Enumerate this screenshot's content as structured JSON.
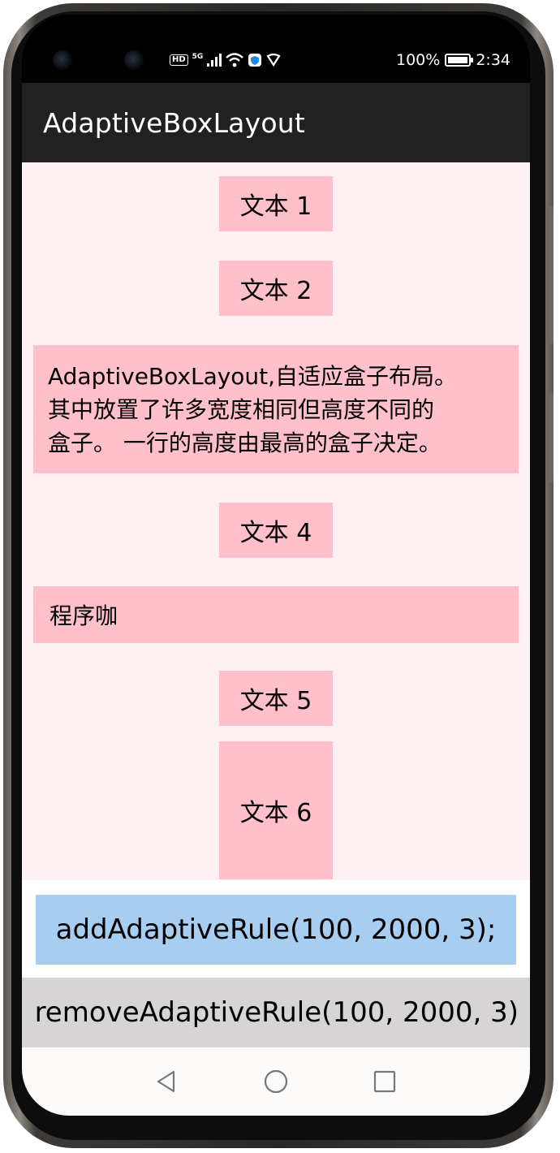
{
  "status_bar": {
    "hd": "HD",
    "network": "5G",
    "battery": "100%",
    "time": "2:34"
  },
  "app_bar": {
    "title": "AdaptiveBoxLayout"
  },
  "boxes": {
    "text1": "文本 1",
    "text2": "文本 2",
    "para_line1": "AdaptiveBoxLayout,自适应盒子布局。",
    "para_line2": "其中放置了许多宽度相同但高度不同的",
    "para_line3": "盒子。 一行的高度由最高的盒子决定。",
    "text4": "文本 4",
    "chengxuka": "程序咖",
    "text5": "文本 5",
    "text6": "文本 6"
  },
  "buttons": {
    "add": "addAdaptiveRule(100, 2000, 3);",
    "remove": "removeAdaptiveRule(100, 2000, 3)"
  },
  "colors": {
    "app_bar": "#212121",
    "content_bg": "#fff0f3",
    "box": "#ffc0cb",
    "add_button": "#a7cdf0",
    "remove_button": "#d6d4d4"
  },
  "nav": {
    "icons": [
      "back-icon",
      "home-icon",
      "recents-icon"
    ]
  }
}
